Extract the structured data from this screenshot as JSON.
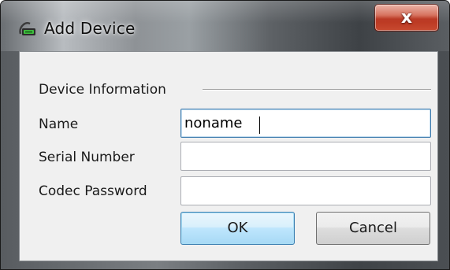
{
  "window": {
    "title": "Add Device",
    "close_label": "x"
  },
  "group": {
    "label": "Device Information"
  },
  "fields": {
    "name_label": "Name",
    "name_value": "noname",
    "serial_label": "Serial Number",
    "serial_value": "",
    "codec_label": "Codec Password",
    "codec_value": ""
  },
  "buttons": {
    "ok_label": "OK",
    "cancel_label": "Cancel"
  },
  "icons": {
    "app_icon": "green-device-icon",
    "close_icon": "close-icon"
  },
  "colors": {
    "close_red": "#c84a30",
    "default_button_blue": "#3c7fb1"
  }
}
